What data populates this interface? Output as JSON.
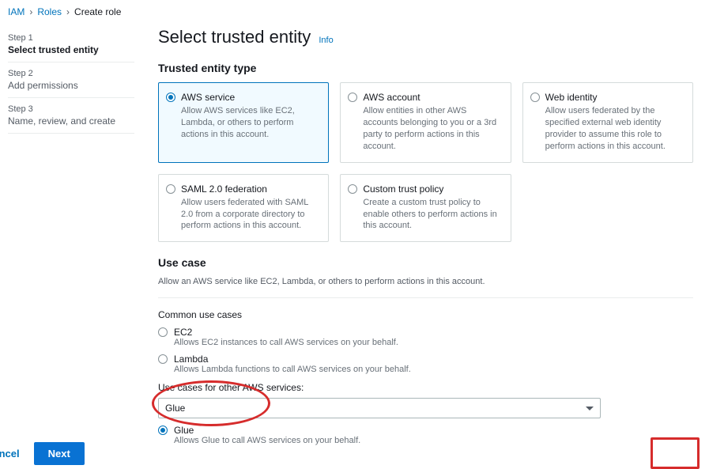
{
  "breadcrumb": {
    "iam": "IAM",
    "roles": "Roles",
    "create": "Create role"
  },
  "steps": {
    "s1_label": "Step 1",
    "s1_title": "Select trusted entity",
    "s2_label": "Step 2",
    "s2_title": "Add permissions",
    "s3_label": "Step 3",
    "s3_title": "Name, review, and create"
  },
  "headings": {
    "page_title": "Select trusted entity",
    "info": "Info",
    "trusted_entity_type": "Trusted entity type",
    "use_case": "Use case",
    "use_case_sub": "Allow an AWS service like EC2, Lambda, or others to perform actions in this account.",
    "common_cases": "Common use cases",
    "other_services": "Use cases for other AWS services:"
  },
  "entities": {
    "aws_service": {
      "title": "AWS service",
      "desc": "Allow AWS services like EC2, Lambda, or others to perform actions in this account."
    },
    "aws_account": {
      "title": "AWS account",
      "desc": "Allow entities in other AWS accounts belonging to you or a 3rd party to perform actions in this account."
    },
    "web_identity": {
      "title": "Web identity",
      "desc": "Allow users federated by the specified external web identity provider to assume this role to perform actions in this account."
    },
    "saml": {
      "title": "SAML 2.0 federation",
      "desc": "Allow users federated with SAML 2.0 from a corporate directory to perform actions in this account."
    },
    "custom": {
      "title": "Custom trust policy",
      "desc": "Create a custom trust policy to enable others to perform actions in this account."
    }
  },
  "use_cases": {
    "ec2": {
      "title": "EC2",
      "desc": "Allows EC2 instances to call AWS services on your behalf."
    },
    "lambda": {
      "title": "Lambda",
      "desc": "Allows Lambda functions to call AWS services on your behalf."
    },
    "glue": {
      "title": "Glue",
      "desc": "Allows Glue to call AWS services on your behalf."
    }
  },
  "dropdown": {
    "selected": "Glue"
  },
  "buttons": {
    "cancel": "Cancel",
    "next": "Next"
  }
}
